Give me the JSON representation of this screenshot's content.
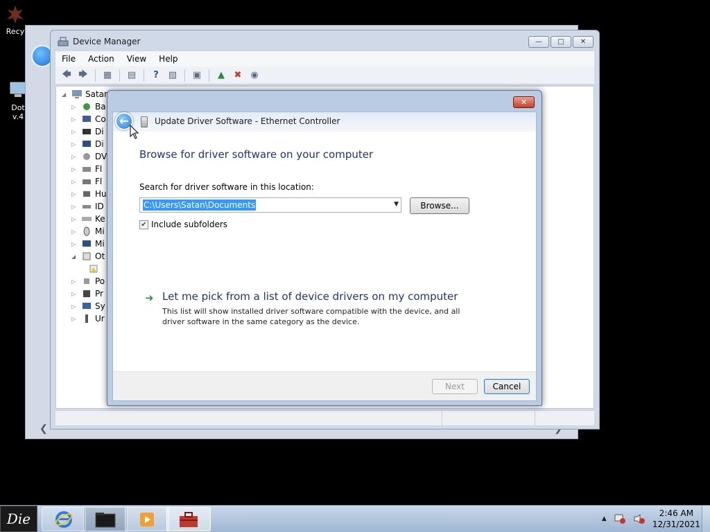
{
  "desktop": {
    "recycle_label": "Recy",
    "dotnet_label_1": "Dot",
    "dotnet_label_2": "v.4"
  },
  "device_manager": {
    "title": "Device Manager",
    "menu": [
      "File",
      "Action",
      "View",
      "Help"
    ],
    "tree_root": "Satan",
    "tree_items": [
      "Ba",
      "Co",
      "Di",
      "Di",
      "DV",
      "Fl",
      "Fl",
      "Hu",
      "ID",
      "Ke",
      "Mi",
      "Mi",
      "Ot",
      "",
      "Po",
      "Pr",
      "Sy",
      "Ur"
    ]
  },
  "dialog": {
    "title": "Update Driver Software - Ethernet Controller",
    "heading": "Browse for driver software on your computer",
    "search_label": "Search for driver software in this location:",
    "path_value": "C:\\Users\\Satan\\Documents",
    "browse_label": "Browse...",
    "include_subfolders_label": "Include subfolders",
    "include_subfolders_checked": true,
    "pick_title": "Let me pick from a list of device drivers on my computer",
    "pick_description": "This list will show installed driver software compatible with the device, and all driver software in the same category as the device.",
    "next_label": "Next",
    "cancel_label": "Cancel"
  },
  "taskbar": {
    "start_label": "Die",
    "clock_time": "2:46 AM",
    "clock_date": "12/31/2021"
  }
}
